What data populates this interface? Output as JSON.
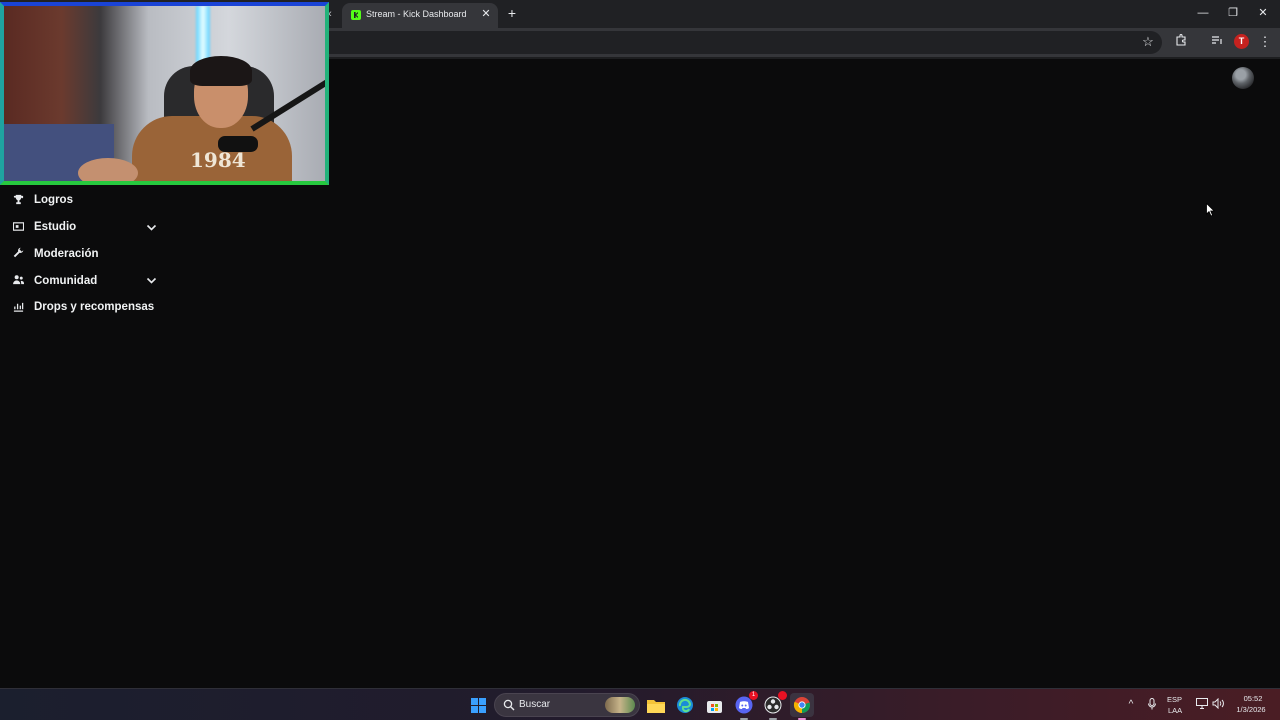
{
  "browser": {
    "tab": {
      "title": "Stream - Kick Dashboard",
      "close_glyph": "✕"
    },
    "new_tab_glyph": "+",
    "window_controls": {
      "minimize": "—",
      "restore": "❐",
      "close": "✕"
    },
    "profile_initial": "T"
  },
  "sidebar": {
    "items": [
      {
        "label": "Logros",
        "icon": "trophy-icon",
        "expandable": false
      },
      {
        "label": "Estudio",
        "icon": "studio-icon",
        "expandable": true
      },
      {
        "label": "Moderación",
        "icon": "wrench-icon",
        "expandable": false
      },
      {
        "label": "Comunidad",
        "icon": "community-icon",
        "expandable": true
      },
      {
        "label": "Drops y recompensas",
        "icon": "drops-icon",
        "expandable": false
      }
    ]
  },
  "webcam": {
    "shirt_text": "1984"
  },
  "taskbar": {
    "search_placeholder": "Buscar",
    "discord_badge": "1",
    "language": {
      "line1": "ESP",
      "line2": "LAA"
    },
    "clock": {
      "time": "05:52",
      "date": "1/3/2026"
    }
  },
  "colors": {
    "kick_green": "#53fc18",
    "background": "#0b0b0c",
    "tab_active": "#35363a"
  }
}
